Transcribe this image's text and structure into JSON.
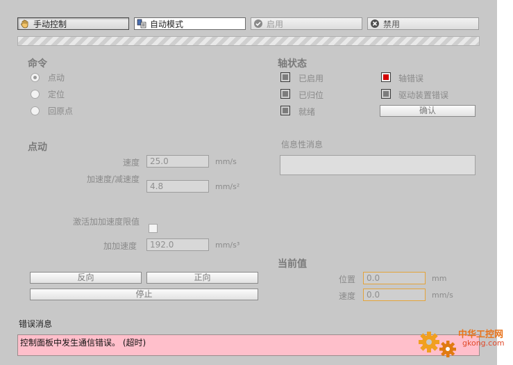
{
  "toolbar": {
    "manual": "手动控制",
    "auto": "自动模式",
    "enable": "启用",
    "disable": "禁用"
  },
  "command": {
    "title": "命令",
    "options": [
      "点动",
      "定位",
      "回原点"
    ],
    "selected": "点动"
  },
  "axis_status": {
    "title": "轴状态",
    "enabled": "已启用",
    "homed": "已归位",
    "ready": "就绪",
    "axis_error": "轴错误",
    "drive_error": "驱动装置错误",
    "confirm": "确认"
  },
  "jog": {
    "title": "点动",
    "speed_label": "速度",
    "speed_value": "25.0",
    "speed_unit": "mm/s",
    "accel_label": "加速度/减速度",
    "accel_value": "4.8",
    "accel_unit": "mm/s²",
    "jerk_enable_label": "激活加加速度限值",
    "jerk_label": "加加速度",
    "jerk_value": "192.0",
    "jerk_unit": "mm/s³",
    "reverse": "反向",
    "forward": "正向",
    "stop": "停止"
  },
  "info": {
    "title": "信息性消息"
  },
  "current": {
    "title": "当前值",
    "position_label": "位置",
    "position_value": "0.0",
    "position_unit": "mm",
    "speed_label": "速度",
    "speed_value": "0.0",
    "speed_unit": "mm/s"
  },
  "error": {
    "title": "错误消息",
    "message": "控制面板中发生通信错误。 (超时)"
  },
  "watermark": {
    "cn": "中华工控网",
    "url": "gkong.com"
  },
  "colors": {
    "panel": "#c8c8c8",
    "error_bg": "#ffbfcb",
    "led_red": "#d40000",
    "field_orange": "#e3a33a"
  }
}
